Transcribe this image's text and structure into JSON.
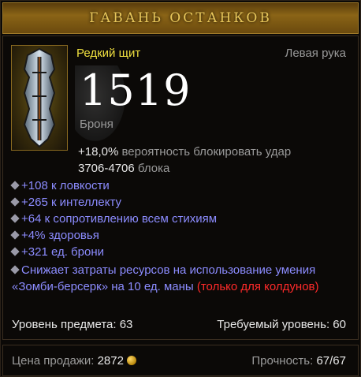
{
  "header": {
    "title": "ГАВАНЬ ОСТАНКОВ"
  },
  "item": {
    "rarity_type": "Редкий щит",
    "slot": "Левая рука",
    "armor_value": "1519",
    "armor_label": "Броня",
    "block_chance_value": "+18,0%",
    "block_chance_text": "вероятность блокировать удар",
    "block_amount_value": "3706-4706",
    "block_amount_text": "блока",
    "icon": "shield-icon"
  },
  "affixes": [
    "+108 к ловкости",
    "+265 к интеллекту",
    "+64 к сопротивлению всем стихиям",
    "+4% здоровья",
    "+321 ед. брони"
  ],
  "special_affix": {
    "text": "Снижает затраты ресурсов на использование умения «Зомби-берсерк» на 10 ед. маны",
    "restriction": "(только для колдунов)"
  },
  "levels": {
    "item_level": "Уровень предмета: 63",
    "required_level": "Требуемый уровень: 60"
  },
  "footer": {
    "sell_price_label": "Цена продажи:",
    "sell_price_value": "2872",
    "durability_label": "Прочность:",
    "durability_value": "67/67"
  },
  "colors": {
    "rare": "#f0e040",
    "magic": "#8c8cff",
    "restriction": "#ff2a2a",
    "title_gold": "#e7c65a"
  }
}
